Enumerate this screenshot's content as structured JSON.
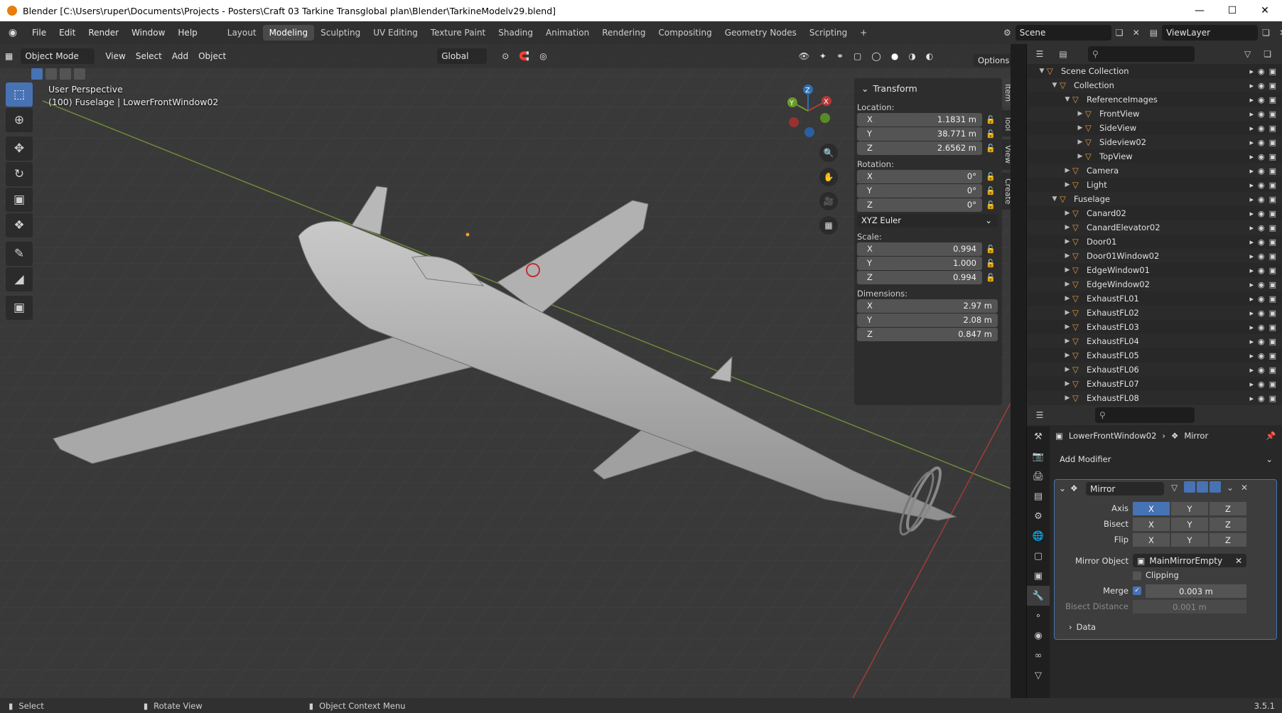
{
  "window": {
    "title": "Blender [C:\\Users\\ruper\\Documents\\Projects - Posters\\Craft 03 Tarkine Transglobal plan\\Blender\\TarkineModelv29.blend]"
  },
  "menus": [
    "File",
    "Edit",
    "Render",
    "Window",
    "Help"
  ],
  "workspaces": [
    "Layout",
    "Modeling",
    "Sculpting",
    "UV Editing",
    "Texture Paint",
    "Shading",
    "Animation",
    "Rendering",
    "Compositing",
    "Geometry Nodes",
    "Scripting"
  ],
  "active_workspace": "Modeling",
  "scene": {
    "name": "Scene",
    "view_layer": "ViewLayer"
  },
  "viewport": {
    "mode": "Object Mode",
    "menus": [
      "View",
      "Select",
      "Add",
      "Object"
    ],
    "orientation": "Global",
    "options": "Options",
    "perspective": "User Perspective",
    "context": "(100) Fuselage | LowerFrontWindow02"
  },
  "npanel": {
    "title": "Transform",
    "location_label": "Location:",
    "location": {
      "x": "1.1831 m",
      "y": "38.771 m",
      "z": "2.6562 m"
    },
    "rotation_label": "Rotation:",
    "rotation": {
      "x": "0°",
      "y": "0°",
      "z": "0°"
    },
    "rotation_mode": "XYZ Euler",
    "scale_label": "Scale:",
    "scale": {
      "x": "0.994",
      "y": "1.000",
      "z": "0.994"
    },
    "dimensions_label": "Dimensions:",
    "dimensions": {
      "x": "2.97 m",
      "y": "2.08 m",
      "z": "0.847 m"
    },
    "axis": {
      "x": "X",
      "y": "Y",
      "z": "Z"
    },
    "tabs": [
      "Item",
      "Tool",
      "View",
      "Create"
    ]
  },
  "outliner": {
    "rows": [
      {
        "label": "Scene Collection",
        "indent": 0
      },
      {
        "label": "Collection",
        "indent": 1
      },
      {
        "label": "ReferenceImages",
        "indent": 2
      },
      {
        "label": "FrontView",
        "indent": 3
      },
      {
        "label": "SideView",
        "indent": 3
      },
      {
        "label": "Sideview02",
        "indent": 3
      },
      {
        "label": "TopView",
        "indent": 3
      },
      {
        "label": "Camera",
        "indent": 2
      },
      {
        "label": "Light",
        "indent": 2
      },
      {
        "label": "Fuselage",
        "indent": 1
      },
      {
        "label": "Canard02",
        "indent": 2
      },
      {
        "label": "CanardElevator02",
        "indent": 2
      },
      {
        "label": "Door01",
        "indent": 2
      },
      {
        "label": "Door01Window02",
        "indent": 2
      },
      {
        "label": "EdgeWindow01",
        "indent": 2
      },
      {
        "label": "EdgeWindow02",
        "indent": 2
      },
      {
        "label": "ExhaustFL01",
        "indent": 2
      },
      {
        "label": "ExhaustFL02",
        "indent": 2
      },
      {
        "label": "ExhaustFL03",
        "indent": 2
      },
      {
        "label": "ExhaustFL04",
        "indent": 2
      },
      {
        "label": "ExhaustFL05",
        "indent": 2
      },
      {
        "label": "ExhaustFL06",
        "indent": 2
      },
      {
        "label": "ExhaustFL07",
        "indent": 2
      },
      {
        "label": "ExhaustFL08",
        "indent": 2
      }
    ]
  },
  "properties": {
    "object": "LowerFrontWindow02",
    "modifier_name": "Mirror",
    "add_modifier": "Add Modifier",
    "axis_label": "Axis",
    "bisect_label": "Bisect",
    "flip_label": "Flip",
    "axes": [
      "X",
      "Y",
      "Z"
    ],
    "mirror_object_label": "Mirror Object",
    "mirror_object": "MainMirrorEmpty",
    "clipping_label": "Clipping",
    "merge_label": "Merge",
    "merge_value": "0.003 m",
    "bisect_distance_label": "Bisect Distance",
    "bisect_distance": "0.001 m",
    "data_label": "Data"
  },
  "status": {
    "select": "Select",
    "rotate": "Rotate View",
    "context": "Object Context Menu",
    "version": "3.5.1"
  },
  "colors": {
    "accent": "#4772b3",
    "x_axis": "#b33a3a",
    "y_axis": "#6a9a2a",
    "z_axis": "#2f6fb5"
  }
}
